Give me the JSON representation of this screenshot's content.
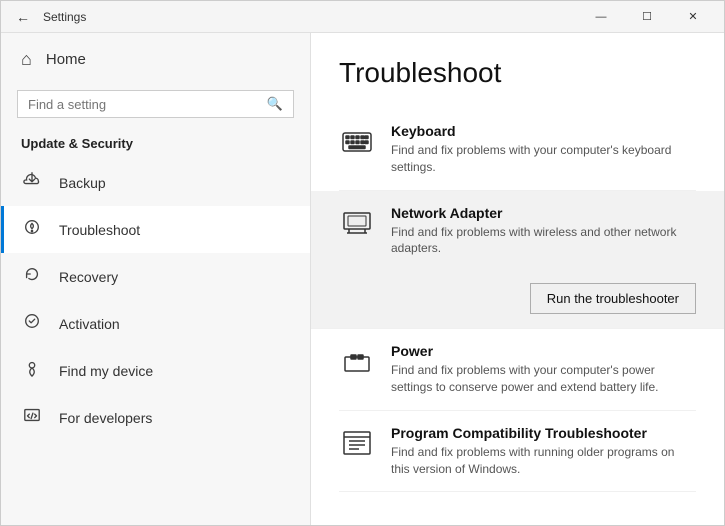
{
  "window": {
    "title": "Settings",
    "controls": {
      "minimize": "—",
      "maximize": "☐",
      "close": "✕"
    }
  },
  "sidebar": {
    "home_label": "Home",
    "search_placeholder": "Find a setting",
    "section_title": "Update & Security",
    "items": [
      {
        "id": "backup",
        "label": "Backup",
        "icon": "backup"
      },
      {
        "id": "troubleshoot",
        "label": "Troubleshoot",
        "icon": "troubleshoot",
        "active": true
      },
      {
        "id": "recovery",
        "label": "Recovery",
        "icon": "recovery"
      },
      {
        "id": "activation",
        "label": "Activation",
        "icon": "activation"
      },
      {
        "id": "find-my-device",
        "label": "Find my device",
        "icon": "find"
      },
      {
        "id": "for-developers",
        "label": "For developers",
        "icon": "developers"
      }
    ]
  },
  "content": {
    "title": "Troubleshoot",
    "items": [
      {
        "id": "keyboard",
        "name": "Keyboard",
        "desc": "Find and fix problems with your computer's keyboard settings.",
        "icon": "keyboard",
        "highlighted": false,
        "show_button": false
      },
      {
        "id": "network-adapter",
        "name": "Network Adapter",
        "desc": "Find and fix problems with wireless and other network adapters.",
        "icon": "network",
        "highlighted": true,
        "show_button": true,
        "button_label": "Run the troubleshooter"
      },
      {
        "id": "power",
        "name": "Power",
        "desc": "Find and fix problems with your computer's power settings to conserve power and extend battery life.",
        "icon": "power",
        "highlighted": false,
        "show_button": false
      },
      {
        "id": "program-compatibility",
        "name": "Program Compatibility Troubleshooter",
        "desc": "Find and fix problems with running older programs on this version of Windows.",
        "icon": "compatibility",
        "highlighted": false,
        "show_button": false
      }
    ]
  }
}
